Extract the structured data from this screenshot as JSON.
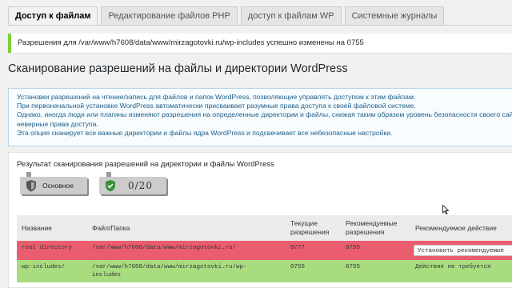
{
  "tabs": [
    {
      "label": "Доступ к файлам"
    },
    {
      "label": "Редактирование файлов PHP"
    },
    {
      "label": "доступ к файлам WP"
    },
    {
      "label": "Системные журналы"
    }
  ],
  "notice": {
    "text": "Разрешения для /var/www/h7608/data/www/mirzagotovki.ru/wp-includes успешно изменены на 0755",
    "color": "#7ad03a"
  },
  "page_title": "Сканирование разрешений на файлы и директории WordPress",
  "info_lines": [
    "Установки разрешений на чтение/запись для файлов и папок WordPress, позволяющие управлять доступом к этим файлам.",
    "При первоначальной установке WordPress автоматически присваивает разумные права доступа к своей файловой системе.",
    "Однако, иногда люди или плагины изменяют разрешения на определенные директории и файлы, снижая таким образом уровень безопасности своего сайта,",
    "неверные права доступа.",
    "Эта опция сканирует все важные директории и файлы ядра WordPress и подсвечивает все небезопасные настройки."
  ],
  "panel": {
    "title": "Результат сканирования разрешений на директории и файлы WordPress",
    "badge_level": "Основное",
    "badge_score": "0/20"
  },
  "table": {
    "headers": {
      "name": "Название",
      "path": "Файл/Папка",
      "current": "Текущие разрешения",
      "recommended": "Рекомендуемые разрешения",
      "action": "Рекомендуемое действие"
    },
    "rows": [
      {
        "name": "root directory",
        "path": "/var/www/h7608/data/www/mirzagotovki.ru/",
        "current": "0777",
        "recommended": "0755",
        "action": "Установить рекомендуемые",
        "status": "bad"
      },
      {
        "name": "wp-includes/",
        "path": "/var/www/h7608/data/www/mirzagotovki.ru/wp-includes",
        "current": "0755",
        "recommended": "0755",
        "action": "Действие не требуется",
        "status": "ok"
      }
    ]
  },
  "colors": {
    "bad_row": "#e95d6e",
    "ok_row": "#a8dc7f",
    "info_text": "#1f5e8a"
  },
  "icons": {
    "badge_level": "shield-icon",
    "badge_score": "shield-check-icon"
  }
}
